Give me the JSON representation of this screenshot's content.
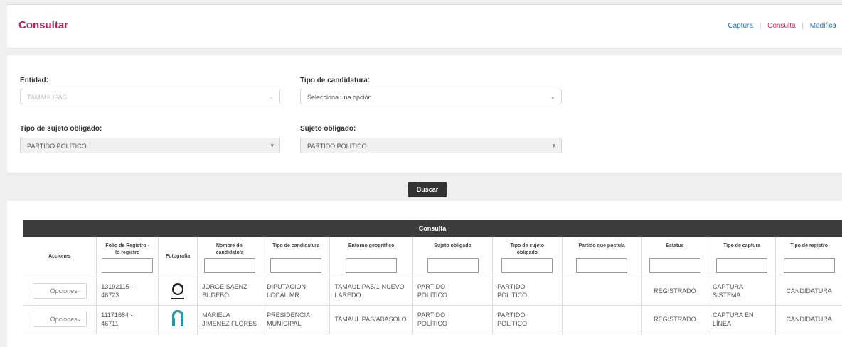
{
  "header": {
    "title": "Consultar",
    "nav": [
      {
        "label": "Captura",
        "active": false
      },
      {
        "label": "Consulta",
        "active": true
      },
      {
        "label": "Modifica",
        "active": false
      }
    ],
    "separator": "|"
  },
  "form": {
    "entidad": {
      "label": "Entidad:",
      "value": "TAMAULIPAS"
    },
    "tipo_candidatura": {
      "label": "Tipo de candidatura:",
      "placeholder": "Selecciona una opción"
    },
    "tipo_sujeto": {
      "label": "Tipo de sujeto obligado:",
      "value": "PARTIDO POLÍTICO"
    },
    "sujeto": {
      "label": "Sujeto obligado:",
      "value": "PARTIDO POLÍTICO"
    }
  },
  "search_label": "Buscar",
  "table": {
    "title": "Consulta",
    "columns": [
      {
        "line1": "Acciones",
        "line2": ""
      },
      {
        "line1": "Folio de Registro -",
        "line2": "Id registro"
      },
      {
        "line1": "Fotografía",
        "line2": ""
      },
      {
        "line1": "Nombre del",
        "line2": "candidato/a"
      },
      {
        "line1": "Tipo de candidatura",
        "line2": ""
      },
      {
        "line1": "Entorno geográfico",
        "line2": ""
      },
      {
        "line1": "Sujeto obligado",
        "line2": ""
      },
      {
        "line1": "Tipo de sujeto",
        "line2": "obligado"
      },
      {
        "line1": "Partido que postula",
        "line2": ""
      },
      {
        "line1": "Estatus",
        "line2": ""
      },
      {
        "line1": "Tipo de captura",
        "line2": ""
      },
      {
        "line1": "Tipo de registro",
        "line2": ""
      }
    ],
    "rows": [
      {
        "acciones": "Opciones",
        "folio_a": "13192115 -",
        "folio_b": "46723",
        "foto": "male-avatar-icon",
        "nombre_a": "JORGE SAENZ",
        "nombre_b": "BUDEBO",
        "tipo_cand_a": "DIPUTACION",
        "tipo_cand_b": "LOCAL MR",
        "entorno_a": "TAMAULIPAS/1-NUEVO",
        "entorno_b": "LAREDO",
        "sujeto_a": "PARTIDO",
        "sujeto_b": "POLÍTICO",
        "tipo_sujeto_a": "PARTIDO",
        "tipo_sujeto_b": "POLÍTICO",
        "partido": "",
        "estatus": "REGISTRADO",
        "captura_a": "CAPTURA",
        "captura_b": "SISTEMA",
        "registro": "CANDIDATURA"
      },
      {
        "acciones": "Opciones",
        "folio_a": "11171684 -",
        "folio_b": "46711",
        "foto": "female-avatar-icon",
        "nombre_a": "MARIELA",
        "nombre_b": "JIMENEZ FLORES",
        "tipo_cand_a": "PRESIDENCIA",
        "tipo_cand_b": "MUNICIPAL",
        "entorno_a": "TAMAULIPAS/ABASOLO",
        "entorno_b": "",
        "sujeto_a": "PARTIDO",
        "sujeto_b": "POLÍTICO",
        "tipo_sujeto_a": "PARTIDO",
        "tipo_sujeto_b": "POLÍTICO",
        "partido": "",
        "estatus": "REGISTRADO",
        "captura_a": "CAPTURA EN",
        "captura_b": "LÍNEA",
        "registro": "CANDIDATURA"
      }
    ]
  },
  "colors": {
    "title": "#c2185b",
    "link": "#1976d2",
    "link_active": "#e91e63",
    "table_header": "#3c3c3c",
    "female_avatar": "#1e9aa6"
  }
}
